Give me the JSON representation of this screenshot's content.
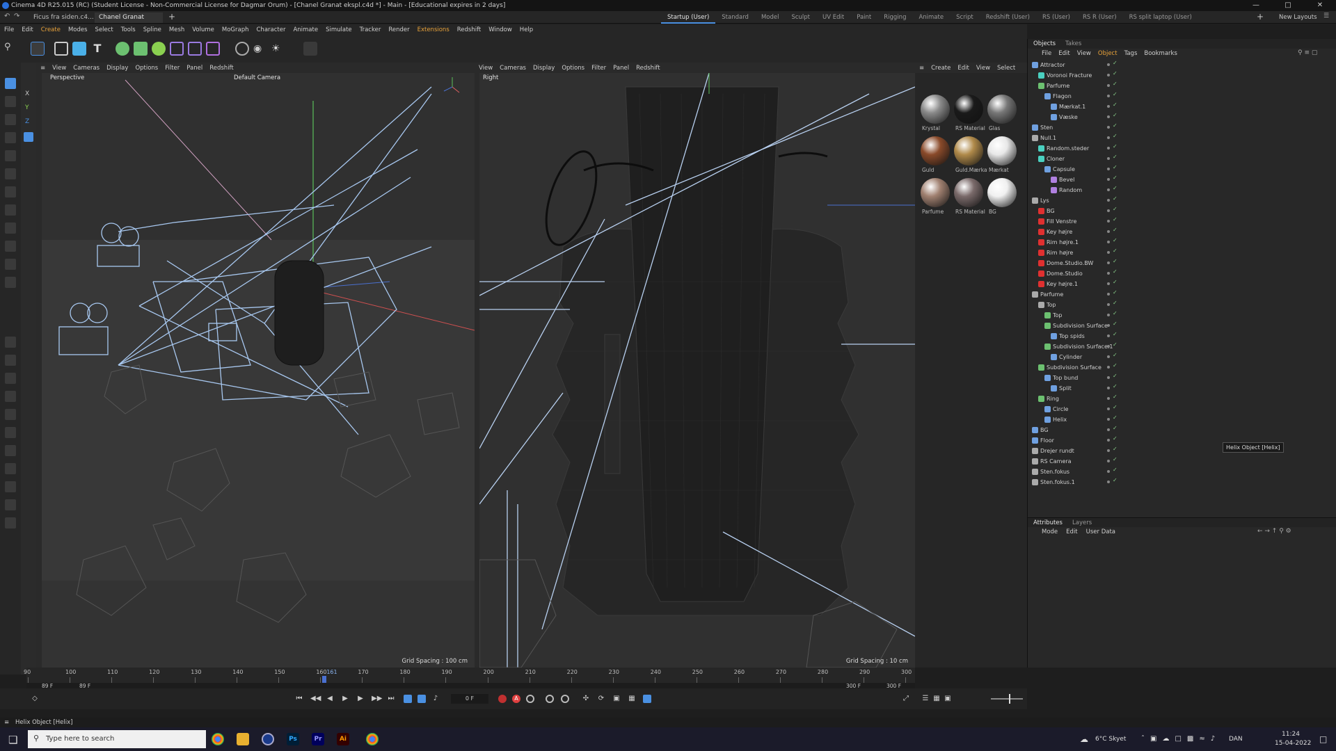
{
  "window": {
    "title": "Cinema 4D R25.015 (RC) (Student License - Non-Commercial License for Dagmar Orum) - [Chanel Granat ekspl.c4d *] - Main - [Educational expires in 2 days]",
    "doc_tabs": [
      "Ficus fra siden.c4...",
      "Chanel Granat ek..."
    ],
    "layouts": [
      "Startup (User)",
      "Standard",
      "Model",
      "Sculpt",
      "UV Edit",
      "Paint",
      "Rigging",
      "Animate",
      "Script",
      "Redshift (User)",
      "RS (User)",
      "RS R (User)",
      "RS split laptop (User)"
    ],
    "new_layouts": "New Layouts"
  },
  "menu": [
    "File",
    "Edit",
    "Create",
    "Modes",
    "Select",
    "Tools",
    "Spline",
    "Mesh",
    "Volume",
    "MoGraph",
    "Character",
    "Animate",
    "Simulate",
    "Tracker",
    "Render",
    "Extensions",
    "Redshift",
    "Window",
    "Help"
  ],
  "viewport_left": {
    "menu": [
      "View",
      "Cameras",
      "Display",
      "Options",
      "Filter",
      "Panel",
      "Redshift"
    ],
    "label": "Perspective",
    "camera": "Default Camera",
    "grid": "Grid Spacing : 100 cm"
  },
  "viewport_right": {
    "menu": [
      "View",
      "Cameras",
      "Display",
      "Options",
      "Filter",
      "Panel",
      "Redshift"
    ],
    "label": "Right",
    "grid": "Grid Spacing : 10 cm"
  },
  "material_panel": {
    "menu": [
      "Create",
      "Edit",
      "View",
      "Select"
    ],
    "materials": [
      {
        "name": "Krystal",
        "color": "#8a8a8a"
      },
      {
        "name": "RS Material",
        "color": "#1a1a1a"
      },
      {
        "name": "Glas",
        "color": "#777777"
      },
      {
        "name": "Guld",
        "color": "#8a4a2a"
      },
      {
        "name": "Guld.Mærkat",
        "color": "#b08a4a"
      },
      {
        "name": "Mærkat",
        "color": "#e8e8e8"
      },
      {
        "name": "Parfume",
        "color": "#a08070"
      },
      {
        "name": "RS Material",
        "color": "#7a6a6a"
      },
      {
        "name": "BG",
        "color": "#f0f0f0"
      }
    ]
  },
  "objects_panel": {
    "tabs": [
      "Objects",
      "Takes"
    ],
    "menu": [
      "File",
      "Edit",
      "View",
      "Object",
      "Tags",
      "Bookmarks"
    ],
    "rows": [
      {
        "name": "Attractor",
        "indent": 0,
        "color": "#6fa0e0"
      },
      {
        "name": "Voronoi Fracture",
        "indent": 1,
        "color": "#4ad0c0"
      },
      {
        "name": "Parfume",
        "indent": 1,
        "color": "#6cc070"
      },
      {
        "name": "Flagon",
        "indent": 2,
        "color": "#6fa0e0"
      },
      {
        "name": "Mærkat.1",
        "indent": 3,
        "color": "#6fa0e0"
      },
      {
        "name": "Væske",
        "indent": 3,
        "color": "#6fa0e0"
      },
      {
        "name": "Sten",
        "indent": 0,
        "color": "#6fa0e0"
      },
      {
        "name": "Null.1",
        "indent": 0,
        "color": "#aaaaaa"
      },
      {
        "name": "Random.steder",
        "indent": 1,
        "color": "#4ad0c0"
      },
      {
        "name": "Cloner",
        "indent": 1,
        "color": "#4ad0c0"
      },
      {
        "name": "Capsule",
        "indent": 2,
        "color": "#6fa0e0"
      },
      {
        "name": "Bevel",
        "indent": 3,
        "color": "#b080e0"
      },
      {
        "name": "Random",
        "indent": 3,
        "color": "#b080e0"
      },
      {
        "name": "Lys",
        "indent": 0,
        "color": "#aaaaaa"
      },
      {
        "name": "BG",
        "indent": 1,
        "color": "#e03030"
      },
      {
        "name": "Fill Venstre",
        "indent": 1,
        "color": "#e03030"
      },
      {
        "name": "Key højre",
        "indent": 1,
        "color": "#e03030"
      },
      {
        "name": "Rim højre.1",
        "indent": 1,
        "color": "#e03030"
      },
      {
        "name": "Rim højre",
        "indent": 1,
        "color": "#e03030"
      },
      {
        "name": "Dome.Studio.BW",
        "indent": 1,
        "color": "#e03030"
      },
      {
        "name": "Dome.Studio",
        "indent": 1,
        "color": "#e03030"
      },
      {
        "name": "Key højre.1",
        "indent": 1,
        "color": "#e03030"
      },
      {
        "name": "Parfume",
        "indent": 0,
        "color": "#aaaaaa"
      },
      {
        "name": "Top",
        "indent": 1,
        "color": "#aaaaaa"
      },
      {
        "name": "Top",
        "indent": 2,
        "color": "#6cc070"
      },
      {
        "name": "Subdivision Surface",
        "indent": 2,
        "color": "#6cc070"
      },
      {
        "name": "Top spids",
        "indent": 3,
        "color": "#6fa0e0"
      },
      {
        "name": "Subdivision Surface.1",
        "indent": 2,
        "color": "#6cc070"
      },
      {
        "name": "Cylinder",
        "indent": 3,
        "color": "#6fa0e0"
      },
      {
        "name": "Subdivision Surface",
        "indent": 1,
        "color": "#6cc070"
      },
      {
        "name": "Top bund",
        "indent": 2,
        "color": "#6fa0e0"
      },
      {
        "name": "Split",
        "indent": 3,
        "color": "#6fa0e0"
      },
      {
        "name": "Ring",
        "indent": 1,
        "color": "#6cc070"
      },
      {
        "name": "Circle",
        "indent": 2,
        "color": "#6fa0e0"
      },
      {
        "name": "Helix",
        "indent": 2,
        "color": "#6fa0e0"
      },
      {
        "name": "BG",
        "indent": 0,
        "color": "#6fa0e0"
      },
      {
        "name": "Floor",
        "indent": 0,
        "color": "#6fa0e0"
      },
      {
        "name": "Drejer rundt",
        "indent": 0,
        "color": "#aaaaaa"
      },
      {
        "name": "RS Camera",
        "indent": 0,
        "color": "#aaaaaa"
      },
      {
        "name": "Sten.fokus",
        "indent": 0,
        "color": "#aaaaaa"
      },
      {
        "name": "Sten.fokus.1",
        "indent": 0,
        "color": "#aaaaaa"
      }
    ],
    "tooltip": "Helix Object [Helix]"
  },
  "attributes_panel": {
    "tabs": [
      "Attributes",
      "Layers"
    ],
    "menu": [
      "Mode",
      "Edit",
      "User Data"
    ]
  },
  "timeline": {
    "ticks": [
      "90",
      "100",
      "110",
      "120",
      "130",
      "140",
      "150",
      "160",
      "170",
      "180",
      "190",
      "200",
      "210",
      "220",
      "230",
      "240",
      "250",
      "260",
      "270",
      "280",
      "290",
      "300"
    ],
    "current": "161",
    "start_a": "89 F",
    "start_b": "89 F",
    "end_a": "300 F",
    "end_b": "300 F",
    "frame": "0 F"
  },
  "status": "Helix Object [Helix]",
  "taskbar": {
    "search_placeholder": "Type here to search",
    "weather": "6°C  Skyet",
    "lang": "DAN",
    "time": "11:24",
    "date": "15-04-2022",
    "apps": [
      {
        "label": "Ps",
        "color": "#31a8ff",
        "bg": "#001e36"
      },
      {
        "label": "Pr",
        "color": "#9999ff",
        "bg": "#00005b"
      },
      {
        "label": "Ai",
        "color": "#ff9a00",
        "bg": "#330000"
      }
    ]
  }
}
